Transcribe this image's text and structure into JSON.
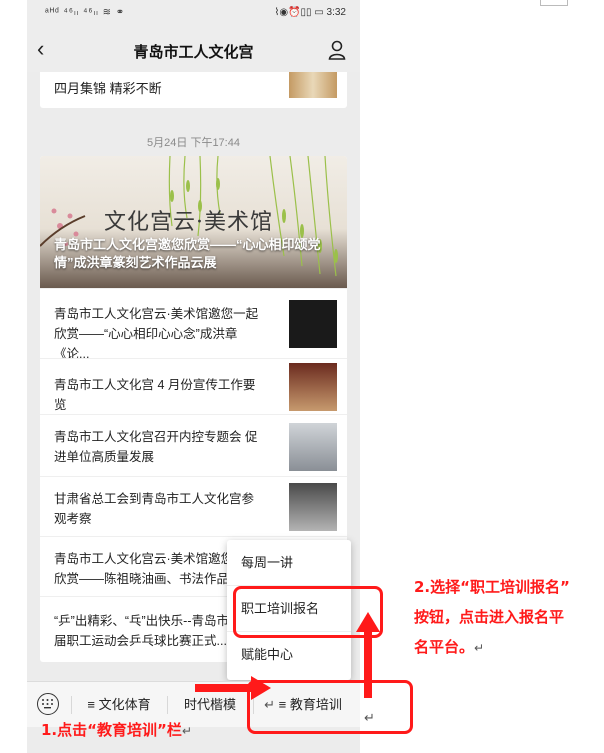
{
  "status_bar": {
    "left": "ᵃᴴᵈ ⁴⁶ₗₗ ⁴⁶ₗₗ ≋ ⚭",
    "right": "⌇◉⏰▯▯ ▭ 3:32"
  },
  "nav": {
    "title": "青岛市工人文化宫"
  },
  "top_card": {
    "text": "四月集锦 精彩不断"
  },
  "timestamp": "5月24日 下午17:44",
  "cover": {
    "calligraphy": "文化宫云·美术馆",
    "title": "青岛市工人文化宫邀您欣赏——“心心相印颂党情”成洪章篆刻艺术作品云展"
  },
  "articles": [
    {
      "title": "青岛市工人文化宫云·美术馆邀您一起欣赏——“心心相印心心念”成洪章《论..."
    },
    {
      "title": "青岛市工人文化宫 4 月份宣传工作要览"
    },
    {
      "title": "青岛市工人文化宫召开内控专题会 促进单位高质量发展"
    },
    {
      "title": "甘肃省总工会到青岛市工人文化宫参观考察"
    },
    {
      "title": "青岛市工人文化宫云·美术馆邀您一起欣赏——陈祖晓油画、书法作品云展"
    },
    {
      "title": "“乒”出精彩、“乓”出快乐--青岛市第十届职工运动会乒乓球比赛正式..."
    }
  ],
  "submenu": {
    "items": [
      "每周一讲",
      "职工培训报名",
      "赋能中心"
    ]
  },
  "bottom_menu": {
    "tabs": [
      "≡ 文化体育",
      "时代楷模",
      "≡ 教育培训"
    ]
  },
  "annotations": {
    "step1": "1.点击“教育培训”栏",
    "step2_line1": "2.选择“职工培训报名”",
    "step2_line2": "按钮，点击进入报名平",
    "step2_line3": "名平台。",
    "return_mark": "↵"
  },
  "colors": {
    "annotation_red": "#ff1a1a",
    "background": "#ececec"
  }
}
